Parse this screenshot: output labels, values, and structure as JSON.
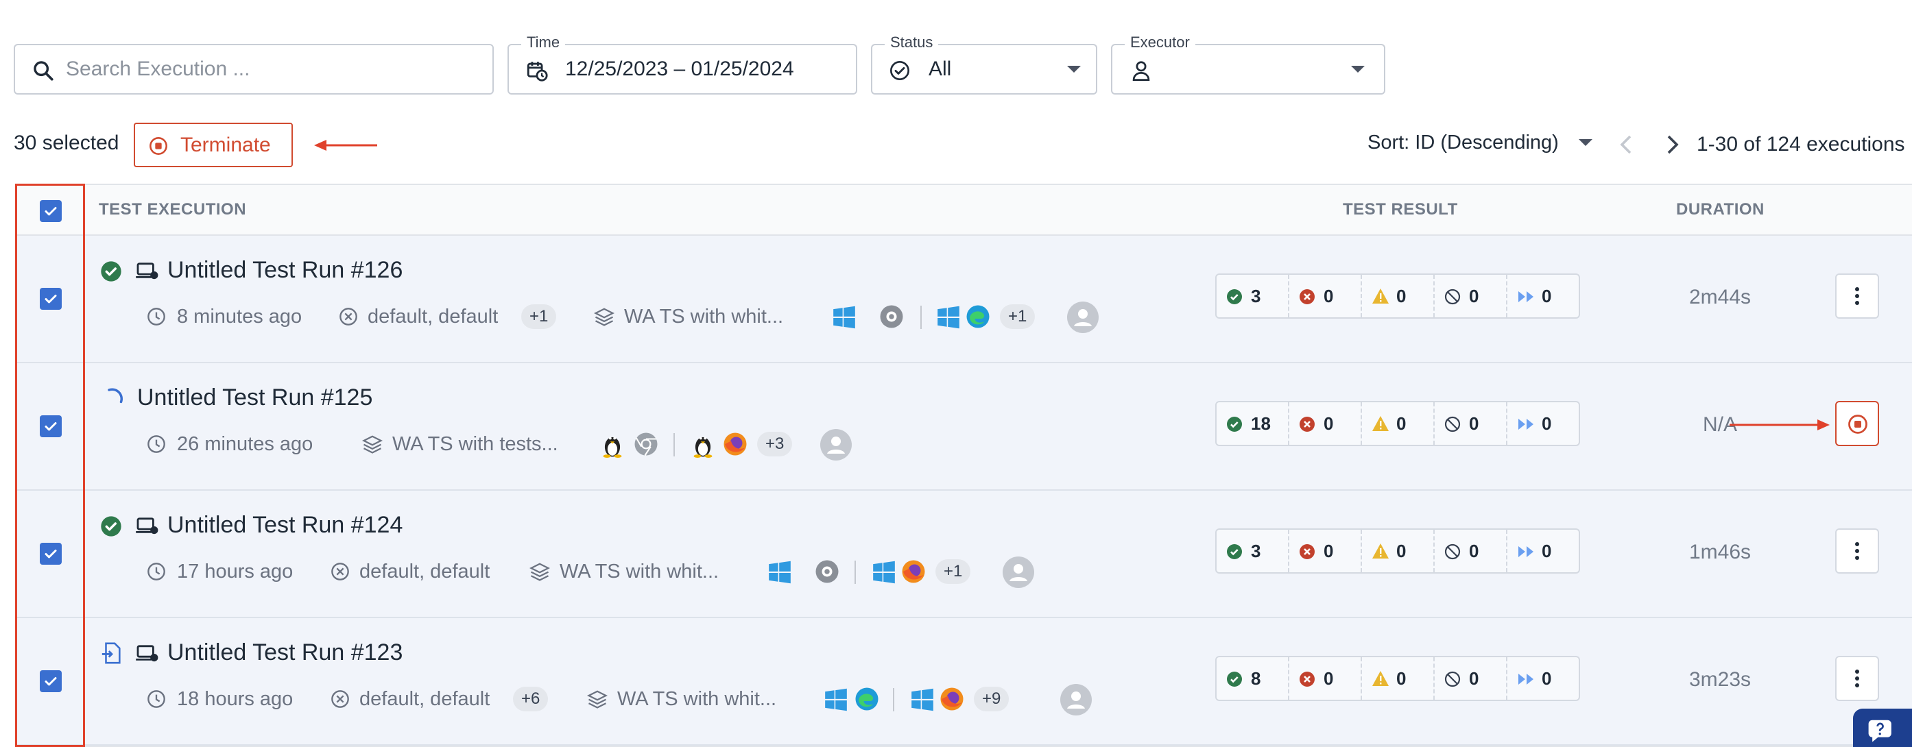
{
  "filters": {
    "search": {
      "placeholder": "Search Execution ..."
    },
    "time": {
      "label": "Time",
      "value": "12/25/2023 – 01/25/2024"
    },
    "status": {
      "label": "Status",
      "value": "All"
    },
    "executor": {
      "label": "Executor",
      "value": ""
    }
  },
  "selection": {
    "count_label": "30 selected",
    "terminate_label": "Terminate"
  },
  "sort": {
    "label": "Sort: ID (Descending)"
  },
  "pagination": {
    "label": "1-30 of 124 executions"
  },
  "table": {
    "headers": {
      "execution": "TEST EXECUTION",
      "result": "TEST RESULT",
      "duration": "DURATION"
    },
    "rows": [
      {
        "title": "Untitled Test Run #126",
        "time": "8 minutes ago",
        "profile": "default, default",
        "profile_extra": "+1",
        "suite": "WA TS with whit...",
        "env_extra": "+1",
        "results": [
          "3",
          "0",
          "0",
          "0",
          "0"
        ],
        "duration": "2m44s",
        "status": "passed"
      },
      {
        "title": "Untitled Test Run #125",
        "time": "26 minutes ago",
        "profile": "",
        "profile_extra": "",
        "suite": "WA TS with tests...",
        "env_extra": "+3",
        "results": [
          "18",
          "0",
          "0",
          "0",
          "0"
        ],
        "duration": "N/A",
        "status": "running"
      },
      {
        "title": "Untitled Test Run #124",
        "time": "17 hours ago",
        "profile": "default, default",
        "profile_extra": "",
        "suite": "WA TS with whit...",
        "env_extra": "+1",
        "results": [
          "3",
          "0",
          "0",
          "0",
          "0"
        ],
        "duration": "1m46s",
        "status": "passed"
      },
      {
        "title": "Untitled Test Run #123",
        "time": "18 hours ago",
        "profile": "default, default",
        "profile_extra": "+6",
        "suite": "WA TS with whit...",
        "env_extra": "+9",
        "results": [
          "8",
          "0",
          "0",
          "0",
          "0"
        ],
        "duration": "3m23s",
        "status": "queued"
      }
    ]
  },
  "colors": {
    "accent_red": "#d14b30",
    "checkbox_blue": "#3a6fd0",
    "passed_green": "#2f7a4c",
    "failed_red": "#c2412d",
    "warning_yellow": "#e8b630",
    "skipped_blue": "#6a9ff0",
    "row_bg": "#f1f4fa"
  },
  "icons": [
    "search-icon",
    "calendar-clock-icon",
    "check-circle-icon",
    "user-icon",
    "stop-circle-icon",
    "arrow-icon",
    "chevron-left-icon",
    "chevron-right-icon",
    "clock-icon",
    "profile-icon",
    "layers-icon",
    "windows-icon",
    "chrome-icon",
    "edge-icon",
    "firefox-icon",
    "linux-icon",
    "kebab-icon",
    "help-icon"
  ]
}
